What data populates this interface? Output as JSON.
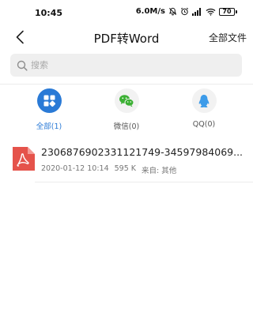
{
  "status_bar": {
    "time": "10:45",
    "network_speed": "6.0M/s",
    "battery_level": "70",
    "icons": [
      "mute-icon",
      "alarm-icon",
      "signal-icon",
      "wifi-icon",
      "battery-icon"
    ]
  },
  "header": {
    "title": "PDF转Word",
    "all_files_label": "全部文件"
  },
  "search": {
    "placeholder": "搜索"
  },
  "tabs": [
    {
      "label": "全部(1)",
      "icon": "grid-icon",
      "active": true
    },
    {
      "label": "微信(0)",
      "icon": "wechat-icon",
      "active": false
    },
    {
      "label": "QQ(0)",
      "icon": "qq-icon",
      "active": false
    }
  ],
  "files": [
    {
      "name": "2306876902331121749-34597984069...",
      "date": "2020-01-12 10:14",
      "size": "595 K",
      "source": "来自: 其他",
      "icon": "pdf-file-icon"
    }
  ],
  "colors": {
    "accent": "#2a7ad6",
    "pdf_red": "#e5534b",
    "wechat_green": "#3cb034",
    "qq_blue": "#3d9be9",
    "tab_icon_bg": "#f2f2f2"
  }
}
